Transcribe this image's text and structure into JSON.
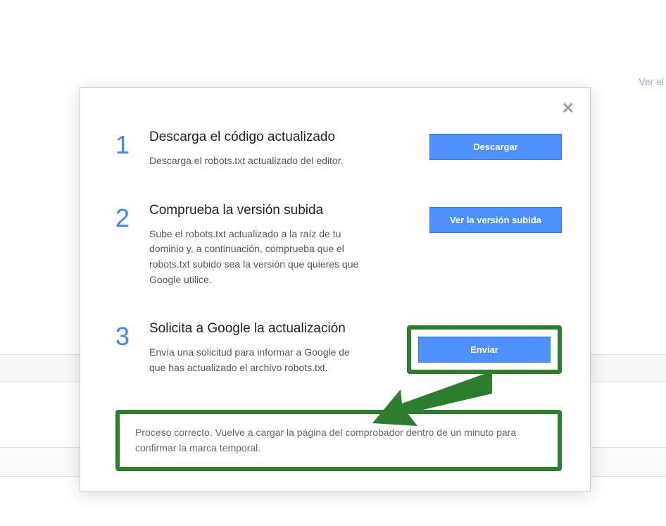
{
  "background": {
    "top_link": "Ver el"
  },
  "modal": {
    "steps": [
      {
        "number": "1",
        "title": "Descarga el código actualizado",
        "description": "Descarga el robots.txt actualizado del editor.",
        "button": "Descargar"
      },
      {
        "number": "2",
        "title": "Comprueba la versión subida",
        "description": "Sube el robots.txt actualizado a la raíz de tu dominio y, a continuación, comprueba que el robots.txt subido sea la versión que quieres que Google utilice.",
        "button": "Ver la versión subida"
      },
      {
        "number": "3",
        "title": "Solicita a Google la actualización",
        "description": "Envía una solicitud para informar a Google de que has actualizado el archivo robots.txt.",
        "button": "Enviar"
      }
    ],
    "status": "Proceso correcto. Vuelve a cargar la página del comprobador dentro de un minuto para confirmar la marca temporal."
  }
}
